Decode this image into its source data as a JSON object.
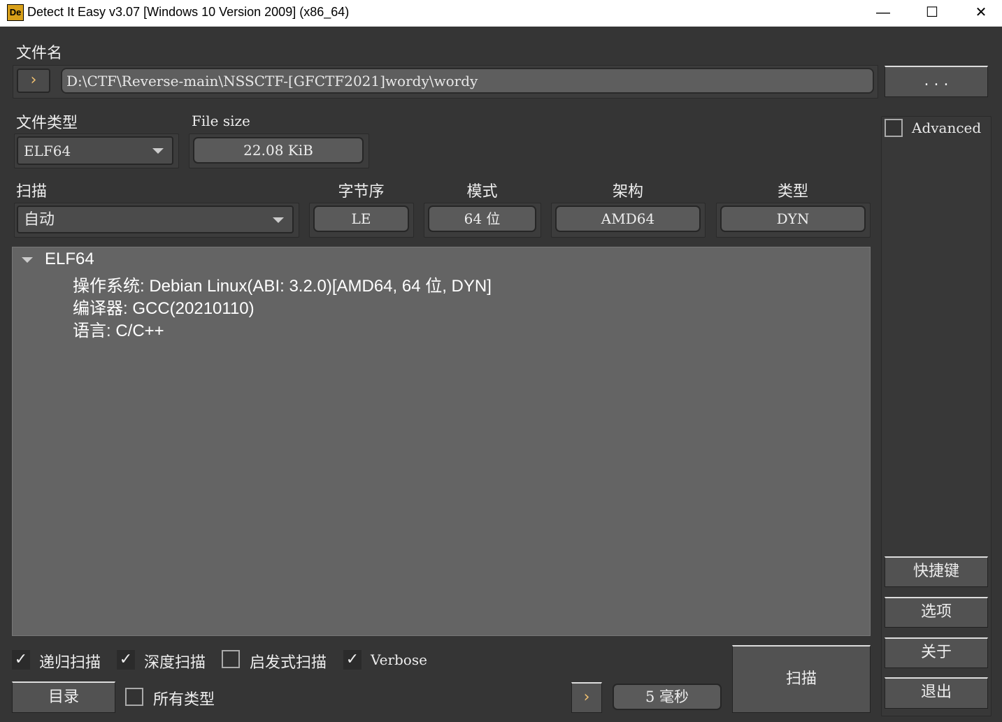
{
  "window": {
    "title": "Detect It Easy v3.07 [Windows 10 Version 2009] (x86_64)",
    "logo": "De",
    "minimize": "—",
    "maximize": "☐",
    "close": "✕"
  },
  "file": {
    "label": "文件名",
    "path": "D:\\CTF\\Reverse-main\\NSSCTF-[GFCTF2021]wordy\\wordy",
    "browse": ". . .",
    "arrow": "›"
  },
  "filetype": {
    "label": "文件类型",
    "value": "ELF64"
  },
  "filesize": {
    "label": "File size",
    "value": "22.08 KiB"
  },
  "scan": {
    "label": "扫描",
    "mode": "自动"
  },
  "info": [
    {
      "label": "字节序",
      "value": "LE"
    },
    {
      "label": "模式",
      "value": "64 位"
    },
    {
      "label": "架构",
      "value": "AMD64"
    },
    {
      "label": "类型",
      "value": "DYN"
    }
  ],
  "results": {
    "root": "ELF64",
    "items": [
      "操作系统: Debian Linux(ABI: 3.2.0)[AMD64, 64 位, DYN]",
      "编译器: GCC(20210110)",
      "语言: C/C++"
    ]
  },
  "options": [
    {
      "label": "递归扫描",
      "checked": true
    },
    {
      "label": "深度扫描",
      "checked": true
    },
    {
      "label": "启发式扫描",
      "checked": false
    },
    {
      "label": "Verbose",
      "checked": true
    }
  ],
  "all_types": {
    "label": "所有类型",
    "checked": false
  },
  "buttons": {
    "directory": "目录",
    "scan": "扫描",
    "time": "5 毫秒",
    "arrow": "›",
    "shortcuts": "快捷键",
    "options": "选项",
    "about": "关于",
    "exit": "退出"
  },
  "advanced": {
    "label": "Advanced",
    "checked": false
  }
}
